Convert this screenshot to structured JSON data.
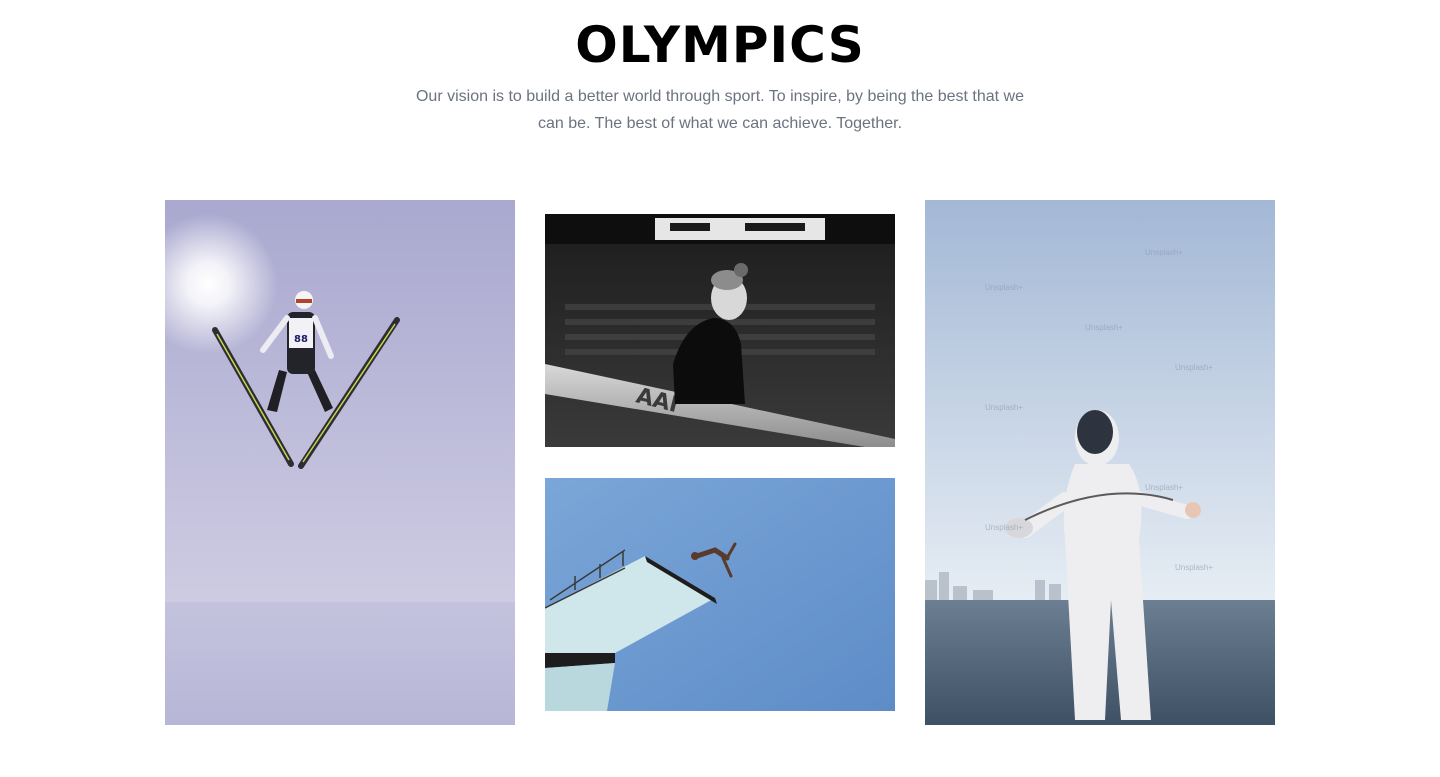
{
  "header": {
    "title": "OLYMPICS",
    "subtitle_line1": "Our vision is to build a better world through sport. To inspire, by being the best that we",
    "subtitle_line2": "can be. The best of what we can achieve. Together."
  },
  "gallery": {
    "images": [
      {
        "subject": "ski-jumper",
        "alt": "Ski jumper in mid-air against a pale sky"
      },
      {
        "subject": "gymnast",
        "alt": "Gymnast beside a balance beam in black and white"
      },
      {
        "subject": "diver",
        "alt": "Diver leaping from a diving platform"
      },
      {
        "subject": "fencer",
        "alt": "Fencer in white with a foil by the sea"
      }
    ],
    "beam_brand": "AAI",
    "watermark": "Unsplash+"
  },
  "colors": {
    "title": "#000000",
    "subtitle": "#6b7280",
    "background": "#ffffff"
  }
}
